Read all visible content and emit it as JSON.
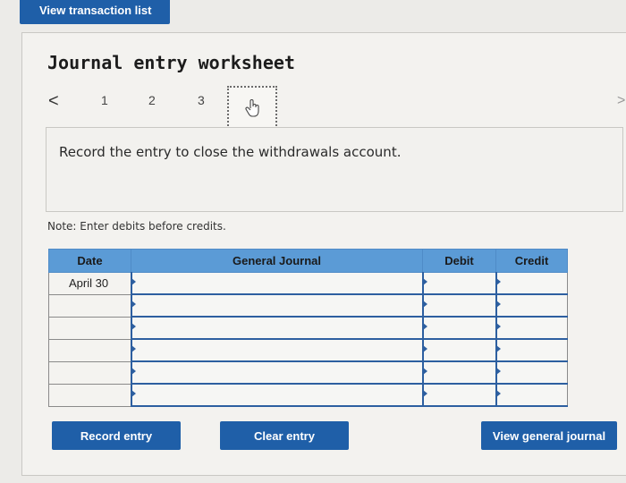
{
  "top_button": {
    "label": "View transaction list"
  },
  "worksheet": {
    "title": "Journal entry worksheet",
    "nav": {
      "prev": "<",
      "steps": [
        "1",
        "2",
        "3"
      ],
      "next": ">"
    },
    "prompt": "Record the entry to close the withdrawals account.",
    "note": "Note: Enter debits before credits."
  },
  "table": {
    "headers": [
      "Date",
      "General Journal",
      "Debit",
      "Credit"
    ],
    "rows": [
      {
        "date": "April 30",
        "journal": "",
        "debit": "",
        "credit": ""
      },
      {
        "date": "",
        "journal": "",
        "debit": "",
        "credit": ""
      },
      {
        "date": "",
        "journal": "",
        "debit": "",
        "credit": ""
      },
      {
        "date": "",
        "journal": "",
        "debit": "",
        "credit": ""
      },
      {
        "date": "",
        "journal": "",
        "debit": "",
        "credit": ""
      },
      {
        "date": "",
        "journal": "",
        "debit": "",
        "credit": ""
      }
    ]
  },
  "buttons": {
    "record": "Record entry",
    "clear": "Clear entry",
    "view_journal": "View general journal"
  },
  "colors": {
    "primary": "#1f5fa8",
    "header": "#5b9bd6",
    "input_border": "#2d5fa0"
  },
  "icons": {
    "current_step": "hand-pointer-icon",
    "prev": "chevron-left-icon",
    "next": "chevron-right-icon"
  }
}
